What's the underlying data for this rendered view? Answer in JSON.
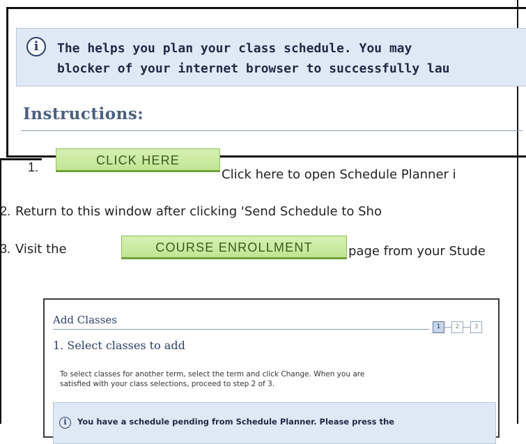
{
  "banner": {
    "icon": "info-icon",
    "line1": "The  helps you plan your class schedule.  You may",
    "line2": "blocker of your internet browser to successfully lau"
  },
  "instructions": {
    "heading": "Instructions:",
    "steps": [
      {
        "number": "1.",
        "button": "CLICK HERE",
        "text": "Click here to open Schedule Planner i"
      },
      {
        "number": "2.",
        "text": "Return to this window after clicking  'Send Schedule to Sho"
      },
      {
        "number": "3.",
        "prefix": "Visit the",
        "button": "COURSE ENROLLMENT",
        "text": "page from your Stude"
      }
    ]
  },
  "embedded": {
    "title": "Add Classes",
    "steps": [
      "1",
      "2",
      "3"
    ],
    "active_step": "1",
    "subtitle": "1.  Select classes to add",
    "help_line1": "To select classes for another term, select the term and click Change.  When you are",
    "help_line2": "satisfied with your class selections, proceed to step 2 of 3.",
    "notice": "You have a schedule pending from Schedule Planner.  Please press the"
  },
  "colors": {
    "banner_bg": "#dfe9f6",
    "button_green": "#c8eb9c",
    "heading": "#4a6080"
  }
}
